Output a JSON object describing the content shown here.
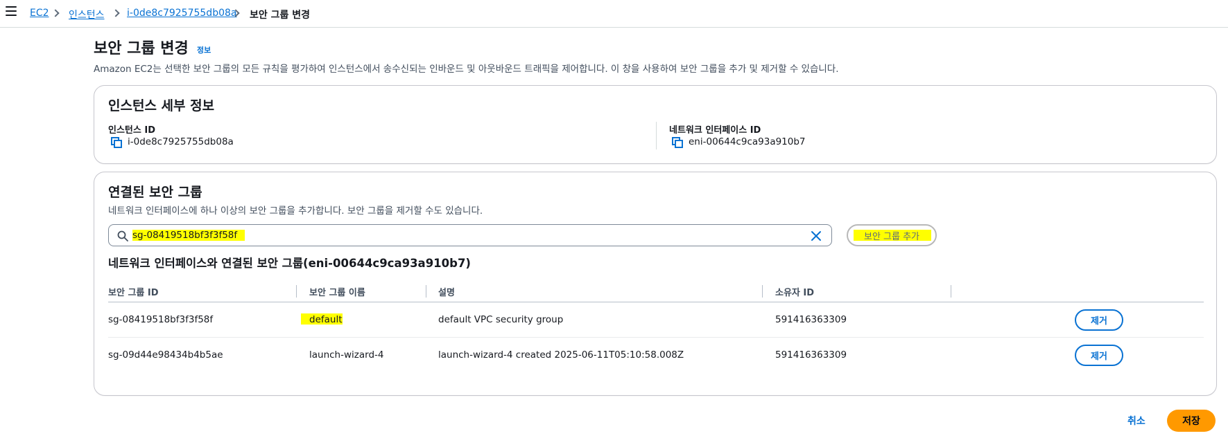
{
  "breadcrumb": {
    "items": [
      {
        "label": "EC2"
      },
      {
        "label": "인스턴스"
      },
      {
        "label": "i-0de8c7925755db08a"
      },
      {
        "label": "보안 그룹 변경"
      }
    ]
  },
  "header": {
    "title": "보안 그룹 변경",
    "info_label": "정보",
    "description": "Amazon EC2는 선택한 보안 그룹의 모든 규칙을 평가하여 인스턴스에서 송수신되는 인바운드 및 아웃바운드 트래픽을 제어합니다. 이 창을 사용하여 보안 그룹을 추가 및 제거할 수 있습니다."
  },
  "instance_details": {
    "title": "인스턴스 세부 정보",
    "instance_id_label": "인스턴스 ID",
    "instance_id": "i-0de8c7925755db08a",
    "eni_label": "네트워크 인터페이스 ID",
    "eni_id": "eni-00644c9ca93a910b7"
  },
  "security_groups": {
    "title": "연결된 보안 그룹",
    "description": "네트워크 인터페이스에 하나 이상의 보안 그룹을 추가합니다. 보안 그룹을 제거할 수도 있습니다.",
    "search_value": "sg-08419518bf3f3f58f",
    "add_button": "보안 그룹 추가",
    "subtitle": "네트워크 인터페이스와 연결된 보안 그룹(eni-00644c9ca93a910b7)",
    "columns": [
      "보안 그룹 ID",
      "보안 그룹 이름",
      "설명",
      "소유자 ID"
    ],
    "rows": [
      {
        "id": "sg-08419518bf3f3f58f",
        "name": "default",
        "description": "default VPC security group",
        "owner": "591416363309",
        "action": "제거"
      },
      {
        "id": "sg-09d44e98434b4b5ae",
        "name": "launch-wizard-4",
        "description": "launch-wizard-4 created 2025-06-11T05:10:58.008Z",
        "owner": "591416363309",
        "action": "제거"
      }
    ]
  },
  "footer": {
    "cancel": "취소",
    "save": "저장"
  },
  "colors": {
    "accent": "#0972d3",
    "primary_button": "#ff9900",
    "highlight": "#ffff00"
  }
}
